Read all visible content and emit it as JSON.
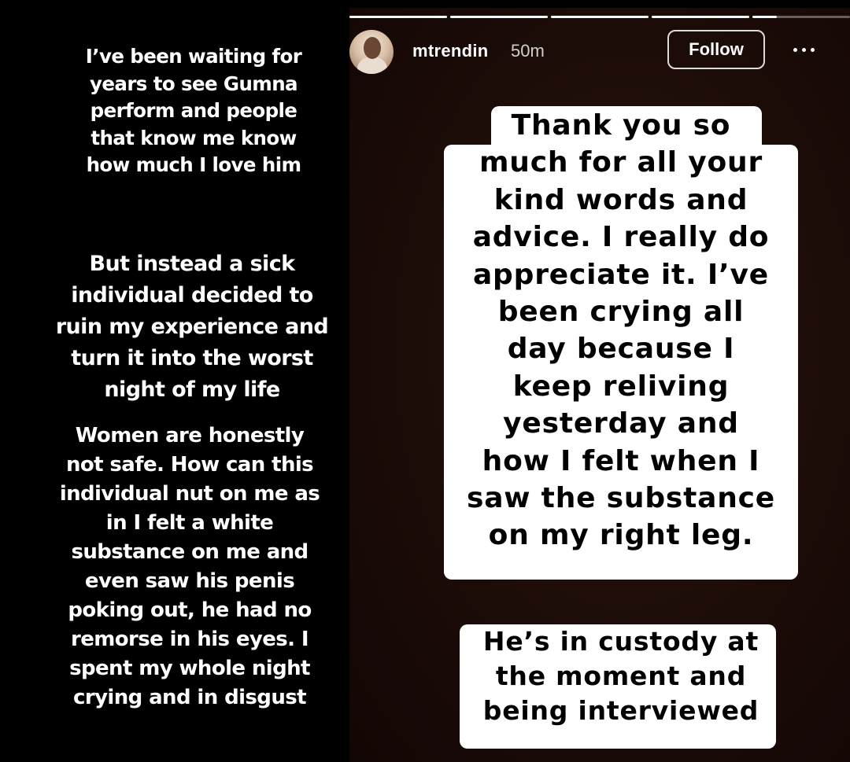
{
  "left_story": {
    "paragraph_1": "I’ve been waiting for\nyears to see Gumna\nperform and people\nthat know me know\nhow much I love him",
    "paragraph_2": "But instead a sick\nindividual decided to\nruin my experience and\nturn it into the worst\nnight of my life",
    "paragraph_3": "Women are honestly\nnot safe. How can this\nindividual nut on me as\nin I felt a white\nsubstance on me and\neven saw his penis\npoking out, he had no\nremorse in his eyes. I\nspent my whole night\ncrying and in disgust"
  },
  "right_story": {
    "progress": [
      1,
      1,
      1,
      1,
      0.25
    ],
    "header": {
      "avatar_icon": "profile-avatar",
      "username": "mtrendin",
      "timestamp": "50m",
      "follow_label": "Follow",
      "more_icon": "more-horizontal-icon"
    },
    "sticker_1": "Thank you so\nmuch for all your\nkind words and\nadvice. I really do\nappreciate it. I’ve\nbeen crying all\nday because I\nkeep reliving\nyesterday and\nhow I felt when I\nsaw the substance\non my right leg.",
    "sticker_2": "He’s in custody at\nthe moment and\nbeing interviewed"
  }
}
